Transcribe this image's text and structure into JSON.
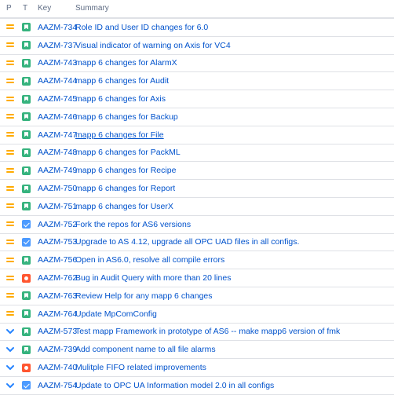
{
  "header": {
    "col_p": "P",
    "col_t": "T",
    "col_key": "Key",
    "col_summary": "Summary"
  },
  "rows": [
    {
      "priority": "medium",
      "type": "story",
      "key": "AAZM-734",
      "summary": "Role ID and User ID changes for 6.0"
    },
    {
      "priority": "medium",
      "type": "story",
      "key": "AAZM-737",
      "summary": "Visual indicator of warning on Axis for VC4"
    },
    {
      "priority": "medium",
      "type": "story",
      "key": "AAZM-743",
      "summary": "mapp 6 changes for AlarmX"
    },
    {
      "priority": "medium",
      "type": "story",
      "key": "AAZM-744",
      "summary": "mapp 6 changes for Audit"
    },
    {
      "priority": "medium",
      "type": "story",
      "key": "AAZM-745",
      "summary": "mapp 6 changes for Axis"
    },
    {
      "priority": "medium",
      "type": "story",
      "key": "AAZM-746",
      "summary": "mapp 6 changes for Backup"
    },
    {
      "priority": "medium",
      "type": "story",
      "key": "AAZM-747",
      "summary": "mapp 6 changes for File"
    },
    {
      "priority": "medium",
      "type": "story",
      "key": "AAZM-748",
      "summary": "mapp 6 changes for PackML"
    },
    {
      "priority": "medium",
      "type": "story",
      "key": "AAZM-749",
      "summary": "mapp 6 changes for Recipe"
    },
    {
      "priority": "medium",
      "type": "story",
      "key": "AAZM-750",
      "summary": "mapp 6 changes for Report"
    },
    {
      "priority": "medium",
      "type": "story",
      "key": "AAZM-751",
      "summary": "mapp 6 changes for UserX"
    },
    {
      "priority": "medium",
      "type": "task",
      "key": "AAZM-752",
      "summary": "Fork the repos for AS6 versions"
    },
    {
      "priority": "medium",
      "type": "task",
      "key": "AAZM-753",
      "summary": "Upgrade to AS 4.12, upgrade all OPC UAD files in all configs."
    },
    {
      "priority": "medium",
      "type": "story",
      "key": "AAZM-756",
      "summary": "Open in AS6.0, resolve all compile errors"
    },
    {
      "priority": "medium",
      "type": "bug",
      "key": "AAZM-762",
      "summary": "Bug in Audit Query with more than 20 lines"
    },
    {
      "priority": "medium",
      "type": "story",
      "key": "AAZM-763",
      "summary": "Review Help for any mapp 6 changes"
    },
    {
      "priority": "medium",
      "type": "story",
      "key": "AAZM-764",
      "summary": "Update MpComConfig"
    },
    {
      "priority": "low",
      "type": "story",
      "key": "AAZM-573",
      "summary": "Test mapp Framework in prototype of AS6 -- make mapp6 version of fmk"
    },
    {
      "priority": "low",
      "type": "story",
      "key": "AAZM-739",
      "summary": "Add component name to all file alarms"
    },
    {
      "priority": "low",
      "type": "bug",
      "key": "AAZM-740",
      "summary": "Mulitple FIFO related improvements"
    },
    {
      "priority": "low",
      "type": "task",
      "key": "AAZM-754",
      "summary": "Update to OPC UA Information model 2.0 in all configs"
    }
  ],
  "hovered_key": "AAZM-747",
  "colors": {
    "priority_medium": "#FFAB00",
    "priority_low": "#2684FF",
    "story": "#36B37E",
    "task": "#4C9AFF",
    "bug": "#FF5630",
    "link": "#0052CC"
  }
}
